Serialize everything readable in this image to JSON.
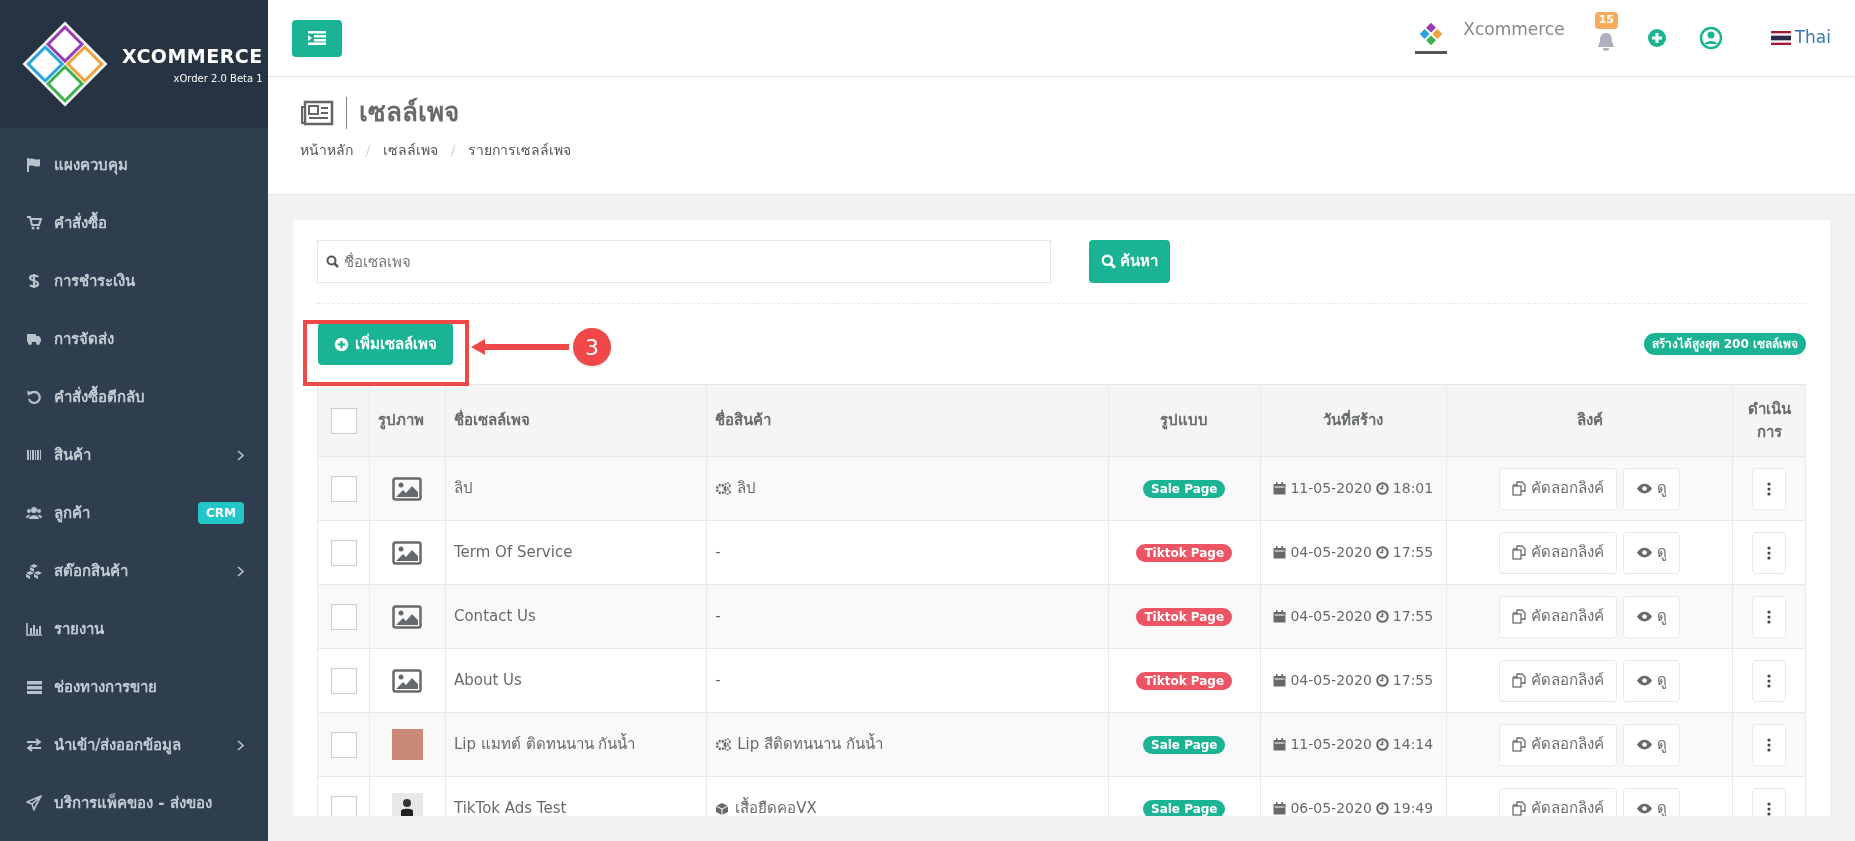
{
  "brand": {
    "name": "XCOMMERCE",
    "version": "xOrder 2.0 Beta 1"
  },
  "sidebar": {
    "items": [
      {
        "label": "แผงควบคุม",
        "has_submenu": false
      },
      {
        "label": "คำสั่งซื้อ",
        "has_submenu": false
      },
      {
        "label": "การชำระเงิน",
        "has_submenu": false
      },
      {
        "label": "การจัดส่ง",
        "has_submenu": false
      },
      {
        "label": "คำสั่งซื้อตีกลับ",
        "has_submenu": false
      },
      {
        "label": "สินค้า",
        "has_submenu": true
      },
      {
        "label": "ลูกค้า",
        "has_submenu": false,
        "badge": "CRM"
      },
      {
        "label": "สต๊อกสินค้า",
        "has_submenu": true
      },
      {
        "label": "รายงาน",
        "has_submenu": false
      },
      {
        "label": "ช่องทางการขาย",
        "has_submenu": false
      },
      {
        "label": "นำเข้า/ส่งออกข้อมูล",
        "has_submenu": true
      },
      {
        "label": "บริการแพ็คของ - ส่งของ",
        "has_submenu": false
      }
    ]
  },
  "topbar": {
    "shop_name": "Xcommerce",
    "notification_count": "15",
    "language": "Thai"
  },
  "page": {
    "title": "เซลล์เพจ",
    "breadcrumb": [
      "หน้าหลัก",
      "เซลล์เพจ",
      "รายการเซลล์เพจ"
    ]
  },
  "search": {
    "placeholder": "ชื่อเซลเพจ",
    "button": "ค้นหา"
  },
  "add_button": "เพิ่มเซลล์เพจ",
  "annotation": "3",
  "limit_badge": "สร้างได้สูงสุด 200 เซลล์เพจ",
  "table": {
    "select_all_checked": false,
    "columns": [
      "รูปภาพ",
      "ชื่อเซลล์เพจ",
      "ชื่อสินค้า",
      "รูปแบบ",
      "วันที่สร้าง",
      "ลิงค์",
      "ดำเนินการ"
    ],
    "rows": [
      {
        "checked": false,
        "thumbnail": {
          "kind": "placeholder"
        },
        "name": "ลิป",
        "product": {
          "kind": "gears",
          "text": "ลิป"
        },
        "type": {
          "kind": "sale",
          "label": "Sale Page"
        },
        "date": "11-05-2020",
        "time": "18:01",
        "copy": "คัดลอกลิงค์",
        "view": "ดู"
      },
      {
        "checked": false,
        "thumbnail": {
          "kind": "placeholder"
        },
        "name": "Term Of Service",
        "product": {
          "kind": "none",
          "text": "-"
        },
        "type": {
          "kind": "tiktok",
          "label": "Tiktok Page"
        },
        "date": "04-05-2020",
        "time": "17:55",
        "copy": "คัดลอกลิงค์",
        "view": "ดู"
      },
      {
        "checked": false,
        "thumbnail": {
          "kind": "placeholder"
        },
        "name": "Contact Us",
        "product": {
          "kind": "none",
          "text": "-"
        },
        "type": {
          "kind": "tiktok",
          "label": "Tiktok Page"
        },
        "date": "04-05-2020",
        "time": "17:55",
        "copy": "คัดลอกลิงค์",
        "view": "ดู"
      },
      {
        "checked": false,
        "thumbnail": {
          "kind": "placeholder"
        },
        "name": "About Us",
        "product": {
          "kind": "none",
          "text": "-"
        },
        "type": {
          "kind": "tiktok",
          "label": "Tiktok Page"
        },
        "date": "04-05-2020",
        "time": "17:55",
        "copy": "คัดลอกลิงค์",
        "view": "ดู"
      },
      {
        "checked": false,
        "thumbnail": {
          "kind": "photo"
        },
        "name": "Lip แมทต์ ติดทนนาน กันน้ำ",
        "product": {
          "kind": "gears",
          "text": "Lip สีติดทนนาน กันน้ำ"
        },
        "type": {
          "kind": "sale",
          "label": "Sale Page"
        },
        "date": "11-05-2020",
        "time": "14:14",
        "copy": "คัดลอกลิงค์",
        "view": "ดู"
      },
      {
        "checked": false,
        "thumbnail": {
          "kind": "person"
        },
        "name": "TikTok Ads Test",
        "product": {
          "kind": "cube",
          "text": "เสื้อยืดคอVX"
        },
        "type": {
          "kind": "sale",
          "label": "Sale Page"
        },
        "date": "06-05-2020",
        "time": "19:49",
        "copy": "คัดลอกลิงค์",
        "view": "ดู"
      }
    ]
  }
}
